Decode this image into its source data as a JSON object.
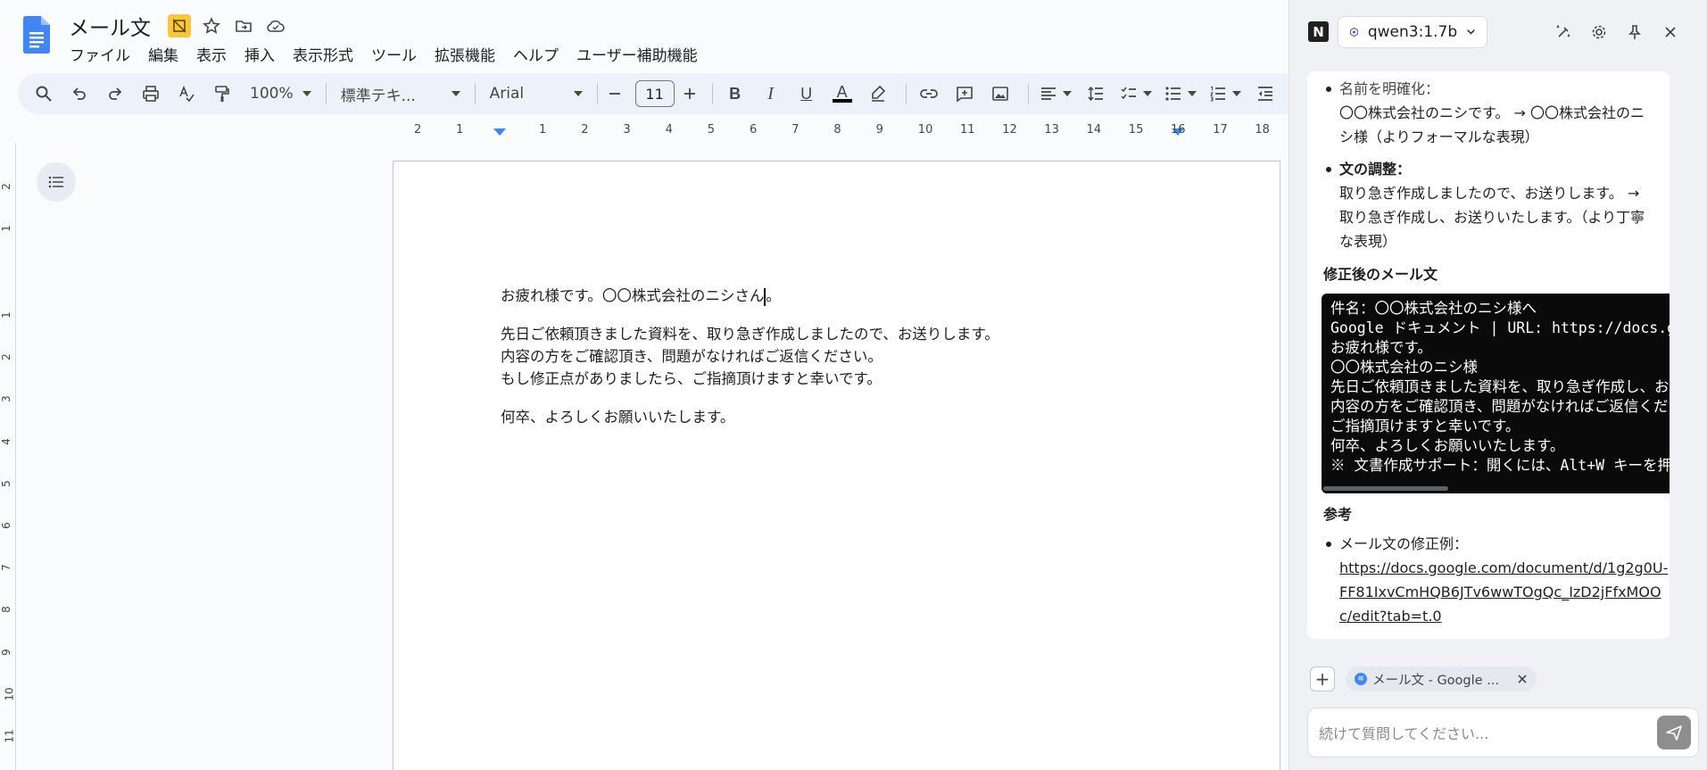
{
  "docs": {
    "title": "メール文",
    "menu": [
      "ファイル",
      "編集",
      "表示",
      "挿入",
      "表示形式",
      "ツール",
      "拡張機能",
      "ヘルプ",
      "ユーザー補助機能"
    ],
    "toolbar": {
      "zoom": "100%",
      "style": "標準テキ...",
      "font": "Arial",
      "font_size": "11"
    },
    "ruler_h": [
      "2",
      "1",
      "1",
      "2",
      "3",
      "4",
      "5",
      "6",
      "7",
      "8",
      "9",
      "10",
      "11",
      "12",
      "13",
      "14",
      "15",
      "16",
      "17",
      "18"
    ],
    "ruler_v": [
      "2",
      "1",
      "1",
      "2",
      "3",
      "4",
      "5",
      "6",
      "7",
      "8",
      "9",
      "10",
      "11"
    ],
    "body": {
      "line1": "お疲れ様です。〇〇株式会社のニシさん",
      "line1_end": "。",
      "line2": "先日ご依頼頂きました資料を、取り急ぎ作成しましたので、お送りします。",
      "line3": " 内容の方をご確認頂き、問題がなければご返信ください。",
      "line4": " もし修正点がありましたら、ご指摘頂けますと幸いです。",
      "line5": "何卒、よろしくお願いいたします。"
    }
  },
  "panel": {
    "model": "qwen3:1.7b",
    "content": {
      "item1_label": "名前を明確化：",
      "item1_line1": "〇〇株式会社のニシです。 → 〇〇株式会社のニ",
      "item1_line2": "シ様（よりフォーマルな表現）",
      "item2_label": "文の調整：",
      "item2_line1": "取り急ぎ作成しましたので、お送りします。 →",
      "item2_line2": "取り急ぎ作成し、お送りいたします。（より丁寧",
      "item2_line3": "な表現）",
      "revised_heading": "修正後のメール文",
      "code_lines": [
        "件名：〇〇株式会社のニシ様へ",
        "Google ドキュメント | URL: https://docs.goo",
        "お疲れ様です。",
        "〇〇株式会社のニシ様",
        "先日ご依頼頂きました資料を、取り急ぎ作成し、お",
        "内容の方をご確認頂き、問題がなければご返信くだ",
        "ご指摘頂けますと幸いです。",
        "何卒、よろしくお願いいたします。",
        "※ 文書作成サポート：開くには、Alt+W キーを押"
      ],
      "ref_heading": "参考",
      "ref_item_label": "メール文の修正例：",
      "ref_link_line1": "https://docs.google.com/document/d/1g2g0U-",
      "ref_link_line2": "FF81IxvCmHQB6JTv6wwTOgQc_IzD2jFfxMOO",
      "ref_link_line3": "c/edit?tab=t.0"
    },
    "chip_label": "メール文 - Google ...",
    "input_placeholder": "続けて質問してください..."
  }
}
